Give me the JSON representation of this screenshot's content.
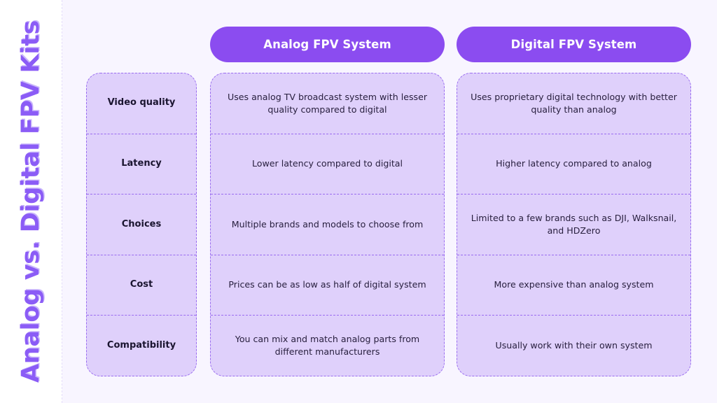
{
  "title": "Analog vs. Digital FPV Kits",
  "colors": {
    "accent_purple": "#8b4cf0",
    "title_purple": "#8b5cf6",
    "cell_fill": "#dfd0fb",
    "cell_border": "#9a6cf0",
    "panel_bg": "#f8f5ff",
    "text_dark": "#29203f"
  },
  "columns": {
    "analog_header": "Analog FPV System",
    "digital_header": "Digital FPV System"
  },
  "rows": [
    {
      "label": "Video quality",
      "analog": "Uses analog TV broadcast system with lesser quality compared to digital",
      "digital": "Uses proprietary digital technology with better quality than analog"
    },
    {
      "label": "Latency",
      "analog": "Lower latency compared to digital",
      "digital": "Higher latency compared to analog"
    },
    {
      "label": "Choices",
      "analog": "Multiple brands and models to choose from",
      "digital": "Limited to a few brands such as DJI, Walksnail, and HDZero"
    },
    {
      "label": "Cost",
      "analog": "Prices can be as low as half of digital system",
      "digital": "More expensive than analog system"
    },
    {
      "label": "Compatibility",
      "analog": "You can mix and match analog parts from different manufacturers",
      "digital": "Usually work with their own system"
    }
  ]
}
